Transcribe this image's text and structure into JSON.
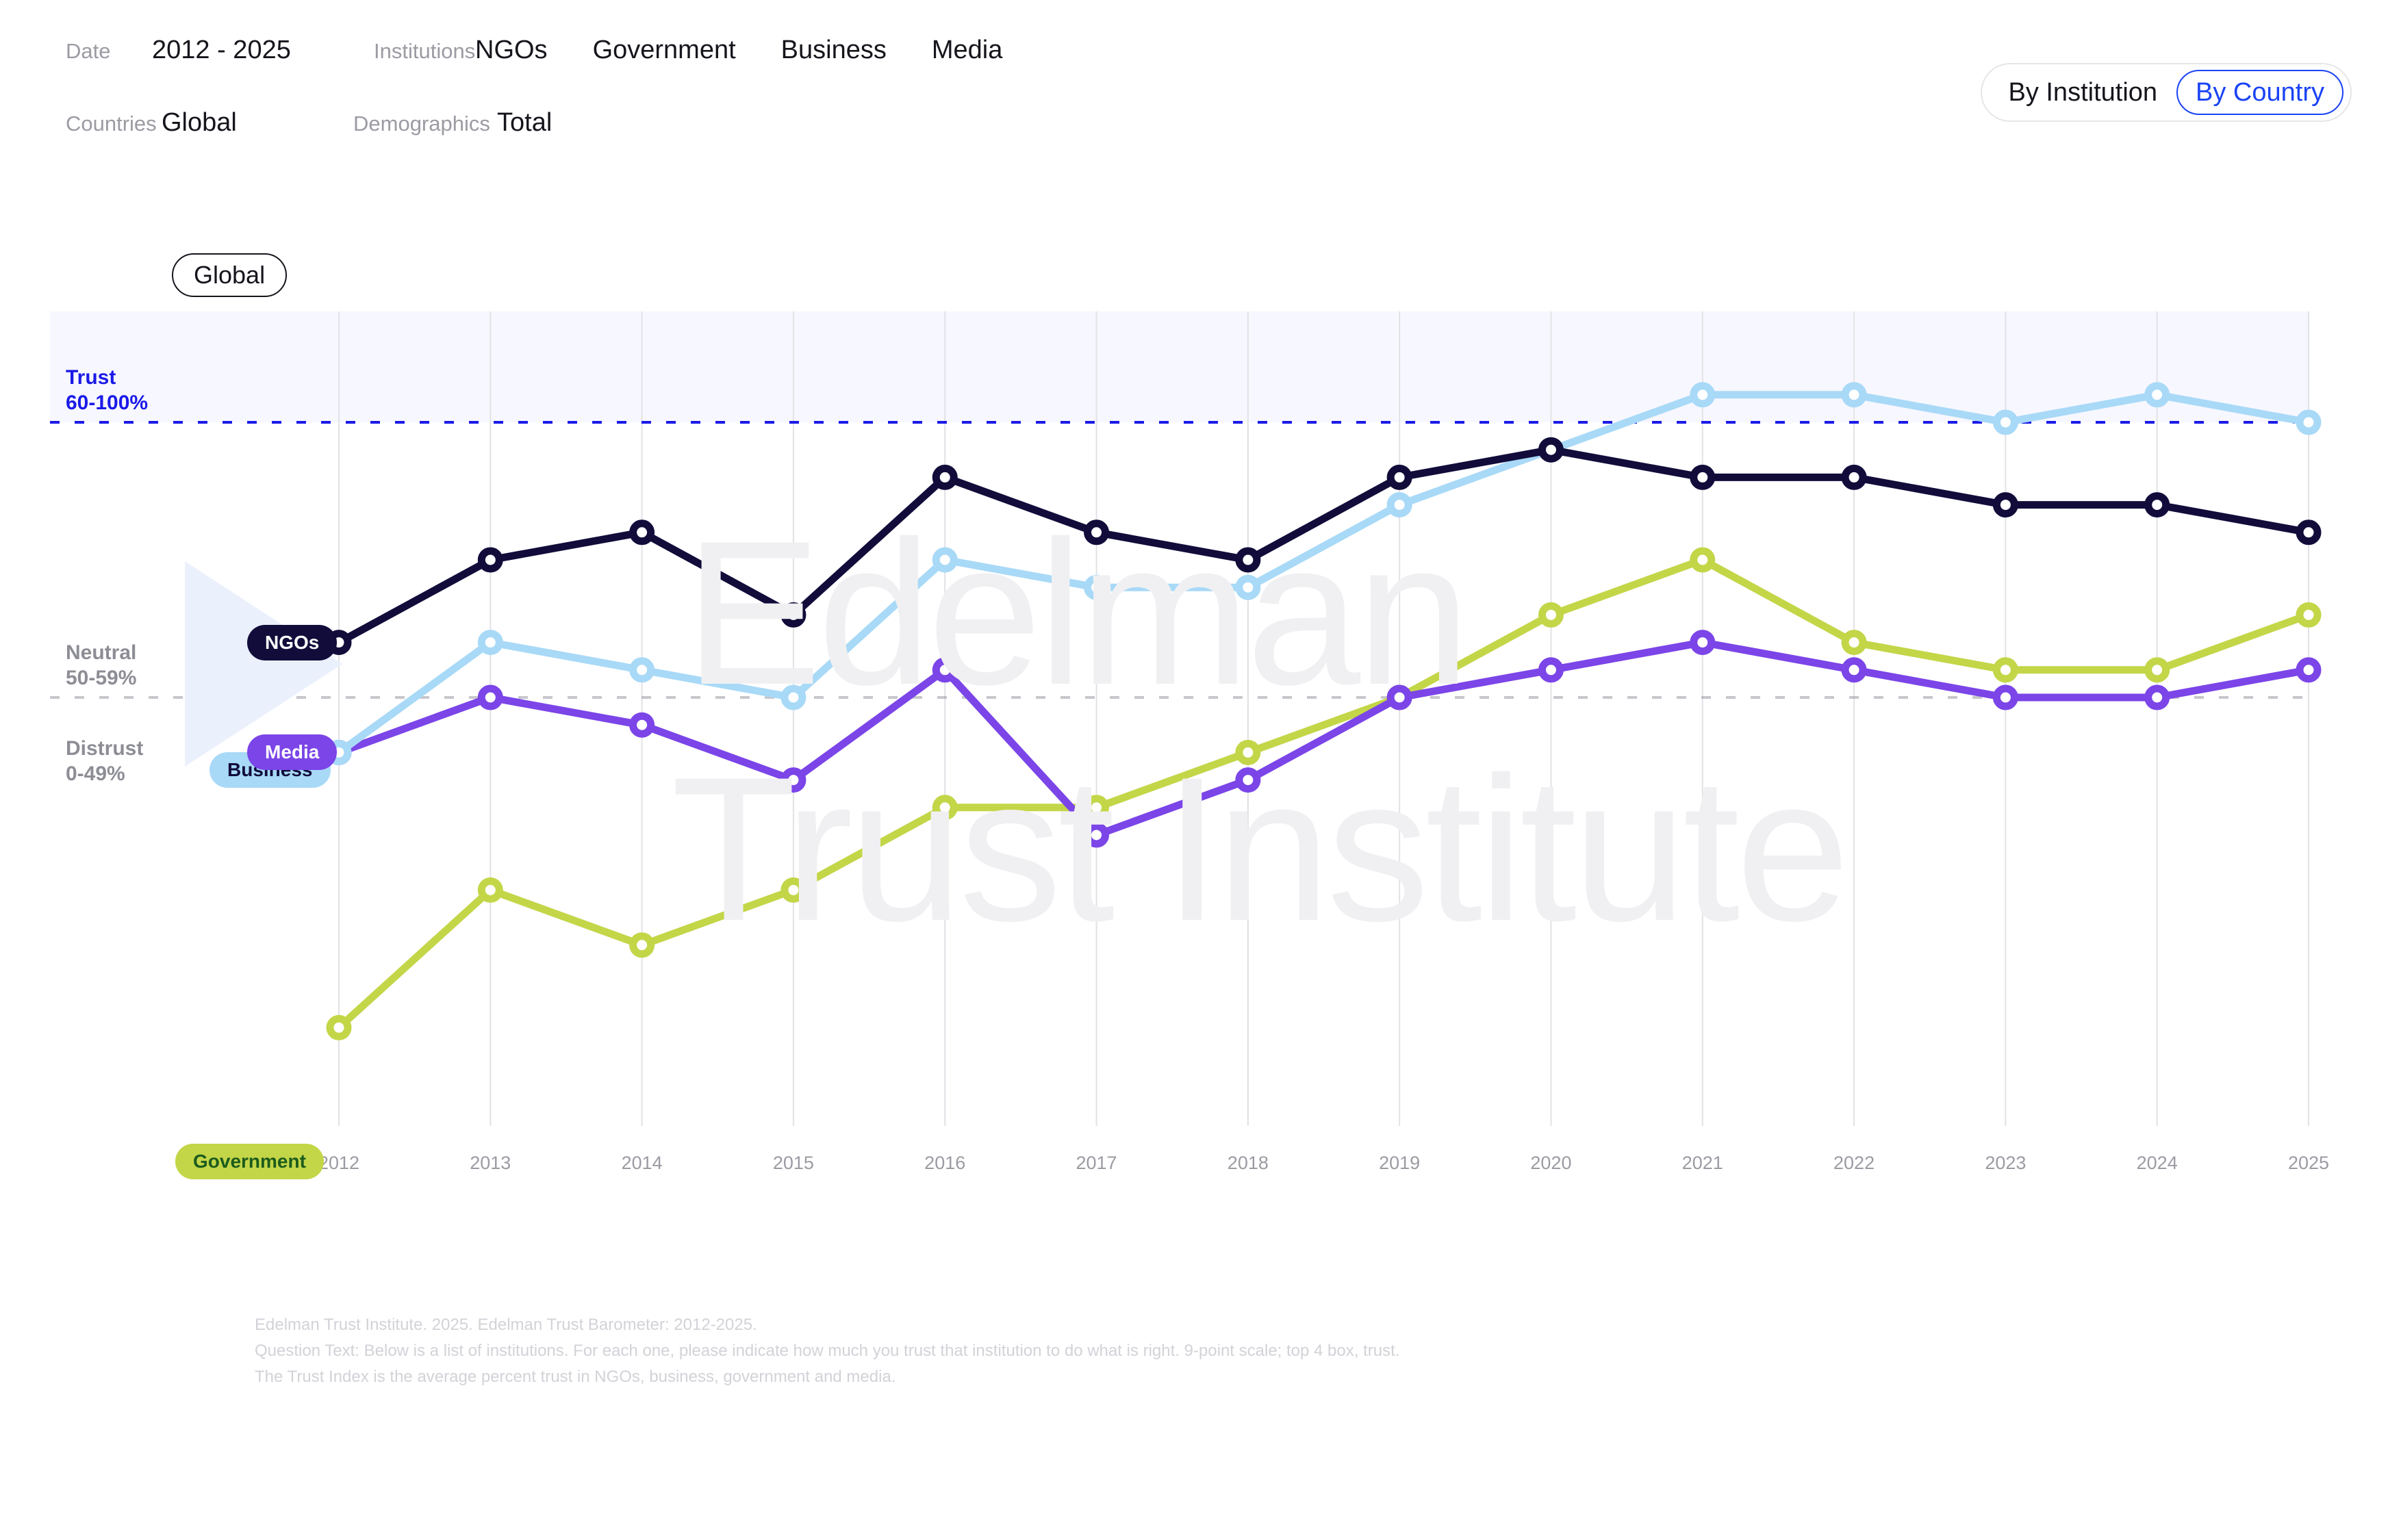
{
  "filters": {
    "date_label": "Date",
    "date_value": "2012 - 2025",
    "institutions_label": "Institutions",
    "institutions": [
      "NGOs",
      "Government",
      "Business",
      "Media"
    ],
    "countries_label": "Countries",
    "countries_value": "Global",
    "demographics_label": "Demographics",
    "demographics_value": "Total"
  },
  "toggle": {
    "by_institution": "By Institution",
    "by_country": "By Country",
    "selected": "By Country",
    "accent": "#1a43f5"
  },
  "chart_header": {
    "region_pill": "Global"
  },
  "bands": {
    "trust_title": "Trust",
    "trust_range": "60-100%",
    "neutral_title": "Neutral",
    "neutral_range": "50-59%",
    "distrust_title": "Distrust",
    "distrust_range": "0-49%",
    "trust_color": "#1a1ae8",
    "neutral_color": "#8d8d96"
  },
  "watermark": {
    "line1": "Edelman",
    "line2": "Trust Institute"
  },
  "notes": [
    "Edelman Trust Institute. 2025. Edelman Trust Barometer: 2012-2025.",
    "Question Text: Below is a list of institutions. For each one, please indicate how much you trust that institution to do what is right. 9-point scale; top 4 box, trust.",
    "The Trust Index is the average percent trust in NGOs, business, government and media."
  ],
  "chart_data": {
    "type": "line",
    "title": "",
    "xlabel": "",
    "ylabel": "",
    "ylim": [
      30,
      66
    ],
    "grid": true,
    "legend_position": "inline-left-badges",
    "reference_lines": [
      {
        "value": 60,
        "label": "Trust 60-100%",
        "color": "#1a1ae8",
        "style": "dashed"
      },
      {
        "value": 50,
        "label": "Neutral 50-59%",
        "color": "#9b9ba3",
        "style": "dashed"
      }
    ],
    "categories": [
      2012,
      2013,
      2014,
      2015,
      2016,
      2017,
      2018,
      2019,
      2020,
      2021,
      2022,
      2023,
      2024,
      2025
    ],
    "series": [
      {
        "name": "NGOs",
        "color": "#110c3a",
        "label_text_color": "#ffffff",
        "values": [
          52,
          55,
          56,
          53,
          58,
          56,
          55,
          58,
          59,
          58,
          58,
          57,
          57,
          56
        ]
      },
      {
        "name": "Business",
        "color": "#a8d9f7",
        "label_text_color": "#110c3a",
        "values": [
          48,
          52,
          51,
          50,
          55,
          54,
          54,
          57,
          59,
          61,
          61,
          60,
          61,
          60
        ]
      },
      {
        "name": "Media",
        "color": "#7b45e8",
        "label_text_color": "#ffffff",
        "values": [
          48,
          50,
          49,
          47,
          51,
          45,
          47,
          50,
          51,
          52,
          51,
          50,
          50,
          51
        ]
      },
      {
        "name": "Government",
        "color": "#c3d648",
        "label_text_color": "#1c5c1c",
        "values": [
          38,
          43,
          41,
          43,
          46,
          46,
          48,
          50,
          53,
          55,
          52,
          51,
          51,
          53
        ]
      }
    ]
  }
}
